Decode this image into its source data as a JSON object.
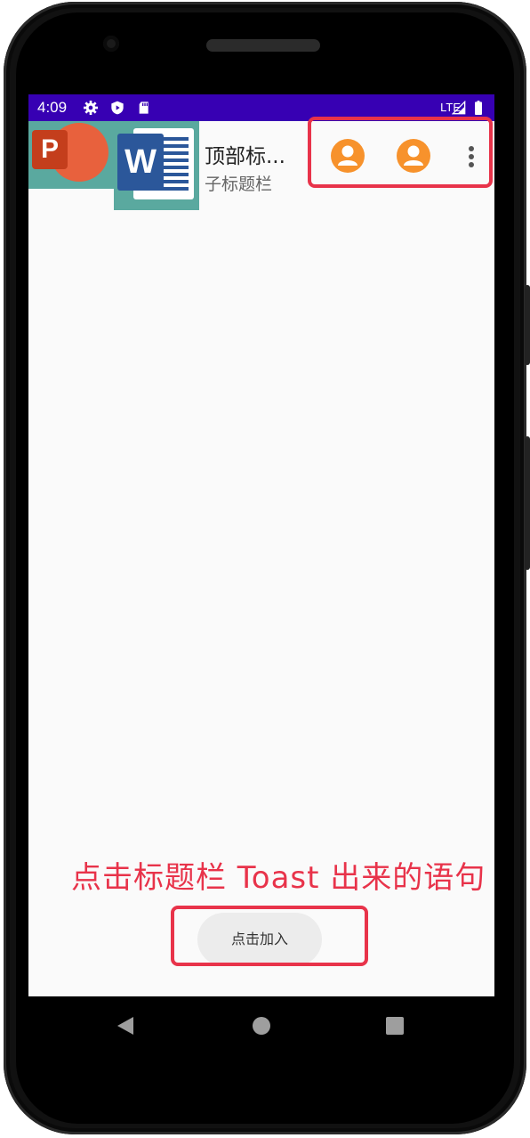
{
  "status_bar": {
    "time": "4:09",
    "network": "LTE",
    "icons": [
      "settings-icon",
      "shield-icon",
      "sd-card-icon",
      "signal-icon",
      "battery-icon"
    ],
    "background": "#3700b3"
  },
  "toolbar": {
    "title": "顶部标...",
    "subtitle": "子标题栏",
    "logo_icons": [
      "powerpoint-icon",
      "word-icon"
    ],
    "ppt_letter": "P",
    "word_letter": "W",
    "actions": [
      "person-icon",
      "person-icon",
      "overflow-menu-icon"
    ],
    "action_color": "#f7922c"
  },
  "annotation": {
    "text": "点击标题栏 Toast 出来的语句",
    "color": "#e8334a"
  },
  "toast": {
    "text": "点击加入"
  },
  "nav_bar": {
    "buttons": [
      "back-icon",
      "home-icon",
      "recent-apps-icon"
    ]
  }
}
